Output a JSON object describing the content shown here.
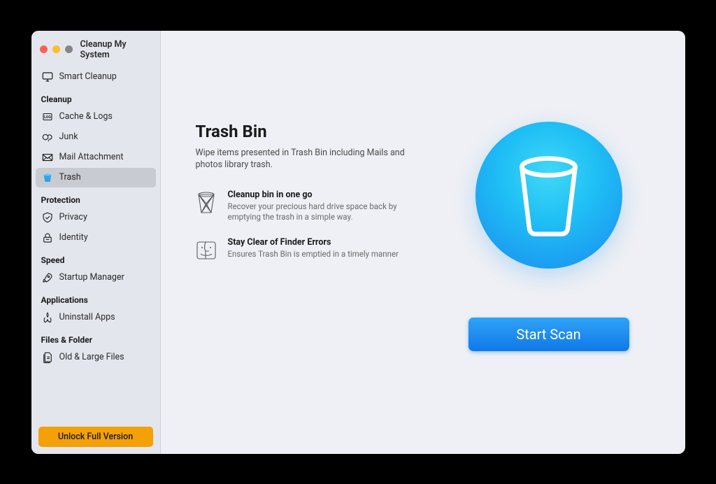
{
  "app": {
    "title": "Cleanup My System"
  },
  "sidebar": {
    "top_item": {
      "label": "Smart Cleanup"
    },
    "sections": [
      {
        "header": "Cleanup",
        "items": [
          {
            "label": "Cache & Logs",
            "icon": "log-icon"
          },
          {
            "label": "Junk",
            "icon": "junk-icon"
          },
          {
            "label": "Mail Attachment",
            "icon": "mail-icon"
          },
          {
            "label": "Trash",
            "icon": "trash-icon",
            "selected": true
          }
        ]
      },
      {
        "header": "Protection",
        "items": [
          {
            "label": "Privacy",
            "icon": "shield-icon"
          },
          {
            "label": "Identity",
            "icon": "lock-icon"
          }
        ]
      },
      {
        "header": "Speed",
        "items": [
          {
            "label": "Startup Manager",
            "icon": "rocket-icon"
          }
        ]
      },
      {
        "header": "Applications",
        "items": [
          {
            "label": "Uninstall Apps",
            "icon": "app-icon"
          }
        ]
      },
      {
        "header": "Files & Folder",
        "items": [
          {
            "label": "Old & Large Files",
            "icon": "files-icon"
          }
        ]
      }
    ],
    "unlock_label": "Unlock Full Version"
  },
  "main": {
    "title": "Trash Bin",
    "description": "Wipe items presented in Trash Bin including Mails and photos library trash.",
    "features": [
      {
        "title": "Cleanup bin in one go",
        "desc": "Recover your precious hard drive space back by emptying the trash in a simple way."
      },
      {
        "title": "Stay Clear of Finder Errors",
        "desc": "Ensures Trash Bin is emptied in a timely manner"
      }
    ],
    "scan_label": "Start Scan"
  }
}
